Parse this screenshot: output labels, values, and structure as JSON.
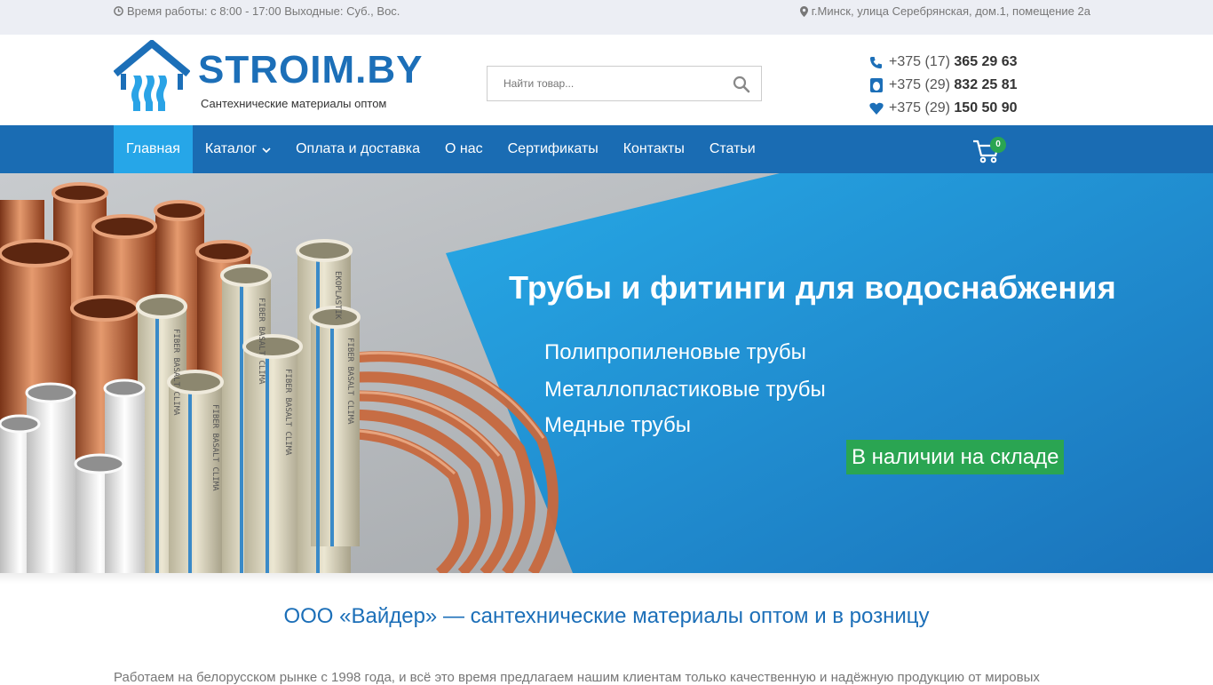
{
  "topbar": {
    "hours": "Время работы: с 8:00 - 17:00 Выходные: Суб., Вос.",
    "address": "г.Минск, улица Серебрянская, дом.1, помещение 2а"
  },
  "logo": {
    "name": "STROIM.BY",
    "tagline": "Сантехнические материалы оптом"
  },
  "search": {
    "placeholder": "Найти товар..."
  },
  "phones": [
    {
      "prefix": "+375 (17) ",
      "number": "365 29 63",
      "icon": "phone-icon"
    },
    {
      "prefix": "+375 (29) ",
      "number": "832 25 81",
      "icon": "mts-icon"
    },
    {
      "prefix": "+375 (29) ",
      "number": "150 50 90",
      "icon": "velcom-icon"
    }
  ],
  "nav": {
    "items": [
      "Главная",
      "Каталог",
      "Оплата и доставка",
      "О нас",
      "Сертификаты",
      "Контакты",
      "Статьи"
    ],
    "active": "Главная",
    "cart_count": "0"
  },
  "banner": {
    "title": "Трубы и фитинги для водоснабжения",
    "items": [
      "Полипропиленовые трубы",
      "Металлопластиковые трубы",
      "Медные трубы"
    ],
    "badge": "В наличии на складе",
    "pipe_prints": [
      "FIBER BASALT CLIMA",
      "EKOPLASTIK"
    ]
  },
  "content": {
    "title": "ООО «Вайдер» — сантехнические материалы оптом и в розницу",
    "text": "Работаем на белорусском рынке с 1998 года, и всё это время предлагаем нашим клиентам только качественную и надёжную продукцию от мировых"
  },
  "colors": {
    "brand_blue": "#1c6fb8",
    "nav_bg": "#1a6cb3",
    "nav_active": "#26a6e8",
    "green": "#2aa552"
  }
}
